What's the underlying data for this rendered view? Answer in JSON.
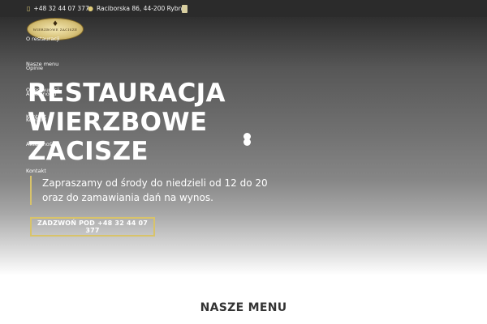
{
  "topbar": {
    "phone": "+48 32 44 07 377",
    "address": "Raciborska 86, 44-200 Rybnik",
    "phone_icon": "phone-icon",
    "location_icon": "location-pin-icon",
    "social_icon": "facebook-icon"
  },
  "logo": {
    "text": "WIERZBOWE ZACISZE"
  },
  "nav": {
    "items": [
      "O restauracji",
      "Nasze menu",
      "Opinie",
      "O restauracji",
      "Aktualności",
      "Kontakt",
      "Kontakt",
      "Aktualności",
      "Kontakt"
    ]
  },
  "hero": {
    "title_lines": [
      "RESTAURACJA",
      "WIERZBOWE",
      "ZACISZE"
    ],
    "intro_lines": [
      "Zapraszamy od środy do niedzieli od 12 do 20",
      "oraz do zamawiania dań na wynos."
    ],
    "cta_label": "ZADZWOŃ POD +48 32 44 07 377"
  },
  "section": {
    "title": "NASZE MENU"
  },
  "colors": {
    "accent": "#d8c36a",
    "topbar_bg": "#2b2b2b",
    "heading": "#333333"
  }
}
